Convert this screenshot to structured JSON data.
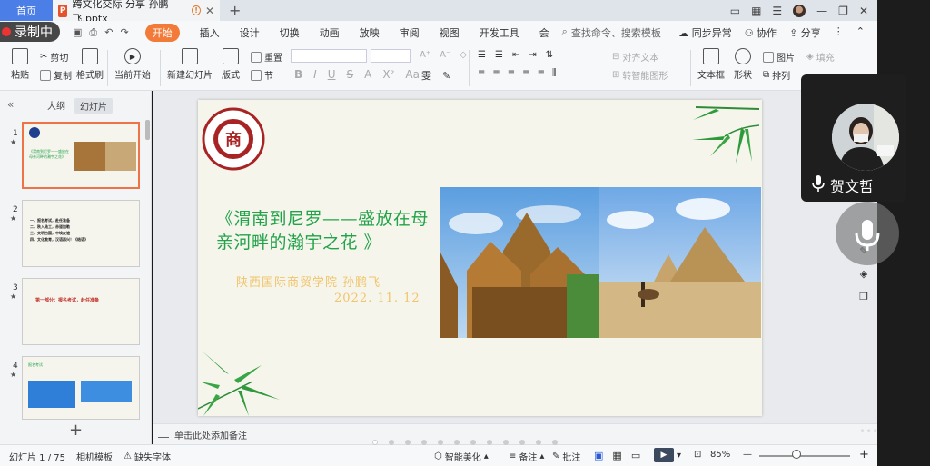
{
  "tabs": {
    "home": "首页",
    "document": "跨文化交际 分享 孙鹏飞.pptx"
  },
  "recording": {
    "label": "录制中"
  },
  "menu": {
    "active": "开始",
    "items": [
      "插入",
      "设计",
      "切换",
      "动画",
      "放映",
      "审阅",
      "视图",
      "开发工具",
      "会"
    ],
    "search": "查找命令、搜索模板",
    "sync": "同步异常",
    "collab": "协作",
    "share": "分享"
  },
  "toolbar": {
    "paste": "粘贴",
    "cut": "剪切",
    "copy": "复制",
    "format_painter": "格式刷",
    "play_from_current": "当前开始",
    "new_slide": "新建幻灯片",
    "layout": "版式",
    "section": "节",
    "reset": "重置",
    "align_text": "对齐文本",
    "smartart": "转智能图形",
    "textbox": "文本框",
    "shape": "形状",
    "image": "图片",
    "fill": "填充",
    "arrange": "排列"
  },
  "left_panel": {
    "tab_outline": "大纲",
    "tab_slides": "幻灯片",
    "thumbs": [
      {
        "num": "1",
        "lines": [
          "《渭南到尼罗——盛放在",
          "母亲河畔的瀚宇之花》"
        ]
      },
      {
        "num": "2",
        "lines": [
          "一、报名考试，赴任准备",
          "二、秋入陆工，赤道加勒",
          "三、文明古国，中埃友谊",
          "四、文化教育，汉语再兴！《结语》"
        ]
      },
      {
        "num": "3",
        "lines": [
          "第一部分：报名考试，赴任准备"
        ]
      },
      {
        "num": "4",
        "lines": [
          "报名考试"
        ]
      }
    ]
  },
  "slide": {
    "title": "《渭南到尼罗——盛放在母亲河畔的瀚宇之花 》",
    "author_line": "陕西国际商贸学院    孙鹏飞",
    "date": "2022. 11. 12",
    "logo_char": "商"
  },
  "notes": {
    "placeholder": "单击此处添加备注"
  },
  "status": {
    "slide_counter": "幻灯片 1 / 75",
    "template": "相机模板",
    "missing_font": "缺失字体",
    "smart_beautify": "智能美化",
    "notes": "备注",
    "comments": "批注",
    "zoom": "85%"
  },
  "participant": {
    "name": "贺文哲"
  },
  "colors": {
    "accent_orange": "#f37b3a",
    "title_green": "#22a34a",
    "subtitle_gold": "#f0c46a",
    "home_tab_blue": "#4c7ee8"
  }
}
